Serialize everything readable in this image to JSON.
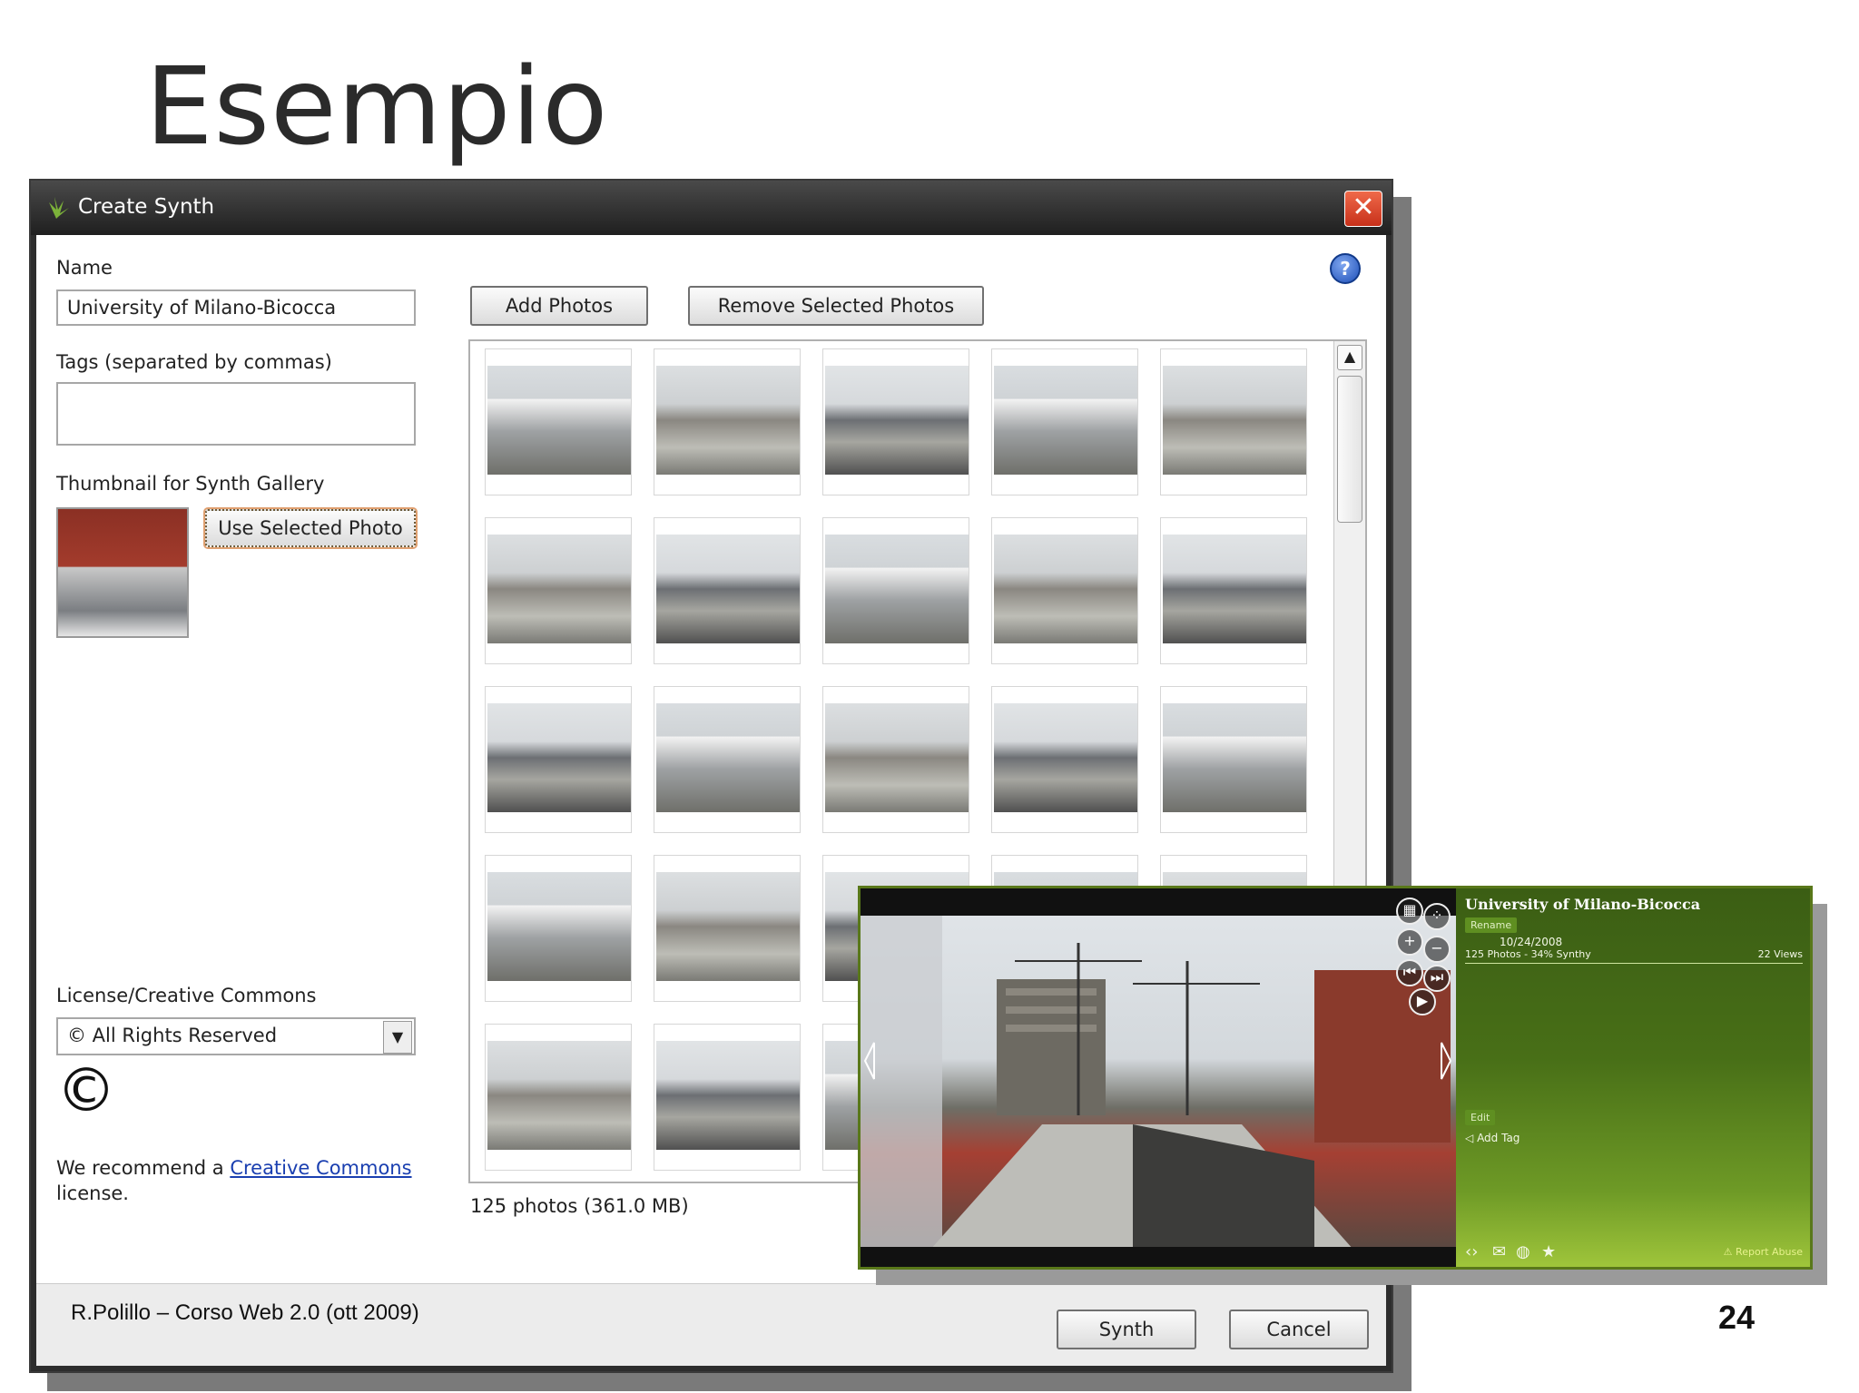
{
  "slide": {
    "title": "Esempio",
    "footer": "R.Polillo – Corso Web 2.0 (ott 2009)",
    "page_number": "24"
  },
  "dialog": {
    "title": "Create Synth",
    "close_glyph": "✕",
    "help_glyph": "?",
    "name_label": "Name",
    "name_value": "University of Milano-Bicocca",
    "tags_label": "Tags (separated by commas)",
    "tags_value": "",
    "thumbnail_label": "Thumbnail for Synth Gallery",
    "use_selected_photo": "Use Selected Photo",
    "add_photos": "Add Photos",
    "remove_selected_photos": "Remove Selected Photos",
    "license_label": "License/Creative Commons",
    "license_value": "© All Rights Reserved",
    "copyright_symbol": "©",
    "recommend_prefix": "We recommend a ",
    "recommend_link": "Creative Commons",
    "recommend_suffix": "license.",
    "photo_count": "125 photos (361.0 MB)",
    "synth_button": "Synth",
    "cancel_button": "Cancel"
  },
  "viewer": {
    "title": "University of Milano-Bicocca",
    "rename": "Rename",
    "date": "10/24/2008",
    "stats": "125 Photos - 34% Synthy",
    "views": "22 Views",
    "edit": "Edit",
    "add_tag": "Add Tag",
    "report_abuse": "Report Abuse"
  }
}
